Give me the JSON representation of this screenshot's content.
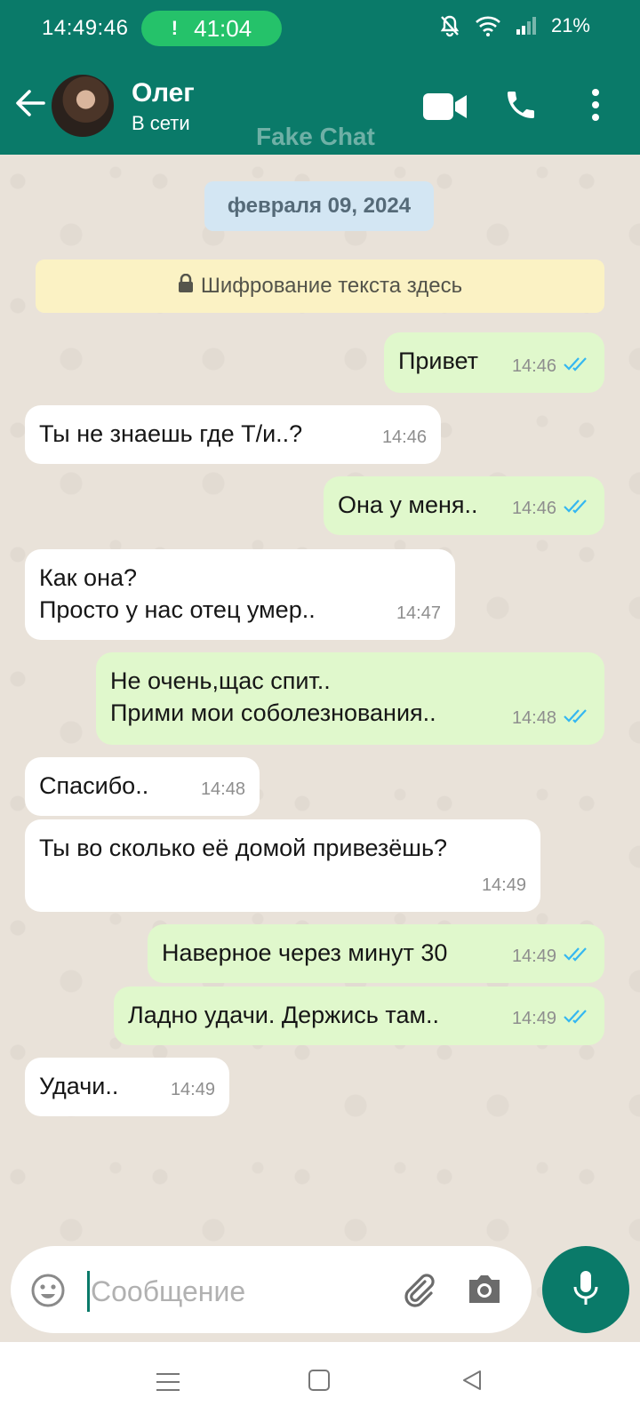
{
  "status_bar": {
    "time": "14:49:46",
    "call_timer": "41:04",
    "call_marker": "!",
    "battery": "21%"
  },
  "header": {
    "contact_name": "Олег",
    "contact_status": "В сети",
    "watermark": "Fake Chat"
  },
  "chat": {
    "date_label": "февраля 09, 2024",
    "encryption_notice": "Шифрование текста здесь",
    "messages": [
      {
        "direction": "out",
        "text": "Привет",
        "time": "14:46",
        "read": true
      },
      {
        "direction": "in",
        "text": "Ты не знаешь где Т/и..?",
        "time": "14:46"
      },
      {
        "direction": "out",
        "text": "Она у меня..",
        "time": "14:46",
        "read": true
      },
      {
        "direction": "in",
        "text": "Как она?\nПросто у нас отец умер..",
        "time": "14:47"
      },
      {
        "direction": "out",
        "text": "Не очень,щас спит..\nПрими мои соболезнования..",
        "time": "14:48",
        "read": true
      },
      {
        "direction": "in",
        "text": "Спасибо..",
        "time": "14:48"
      },
      {
        "direction": "in",
        "text": "Ты во сколько её домой привезёшь?",
        "time": "14:49"
      },
      {
        "direction": "out",
        "text": "Наверное через минут 30",
        "time": "14:49",
        "read": true
      },
      {
        "direction": "out",
        "text": "Ладно удачи. Держись там..",
        "time": "14:49",
        "read": true
      },
      {
        "direction": "in",
        "text": "Удачи..",
        "time": "14:49"
      }
    ]
  },
  "composer": {
    "placeholder": "Сообщение",
    "value": ""
  },
  "colors": {
    "header": "#0a7a69",
    "outgoing_bubble": "#e0f8cc",
    "incoming_bubble": "#ffffff",
    "chat_background": "#e9e2d9",
    "read_ticks": "#34b7f1"
  },
  "icons": {
    "back": "arrow-left",
    "video": "video-camera",
    "phone": "phone",
    "more": "three-dots-vertical",
    "emoji": "smiley",
    "attach": "paperclip",
    "camera": "camera",
    "mic": "microphone"
  }
}
